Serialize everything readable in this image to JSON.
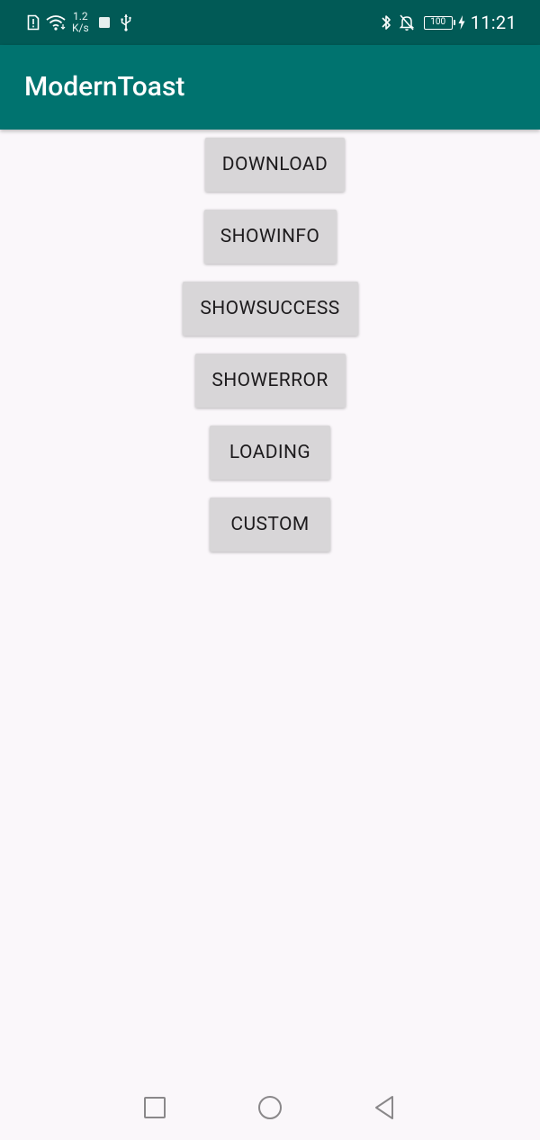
{
  "status_bar": {
    "speed_value": "1.2",
    "speed_unit": "K/s",
    "battery": "100",
    "time": "11:21",
    "icons": [
      "sim-card-icon",
      "wifi-icon",
      "notification-square-icon",
      "usb-icon",
      "bluetooth-icon",
      "notifications-off-icon",
      "battery-icon",
      "charging-icon"
    ]
  },
  "app_bar": {
    "title": "ModernToast"
  },
  "buttons": {
    "download": "DOWNLOAD",
    "showinfo": "SHOWINFO",
    "showsuccess": "SHOWSUCCESS",
    "showerror": "SHOWERROR",
    "loading": "LOADING",
    "custom": "CUSTOM"
  },
  "nav_bar": {
    "icons": [
      "recents-square-icon",
      "home-circle-icon",
      "back-triangle-icon"
    ]
  },
  "colors": {
    "status_bar": "#015a56",
    "app_bar": "#00736f",
    "background": "#faf7fa",
    "button": "#d8d6d8"
  }
}
